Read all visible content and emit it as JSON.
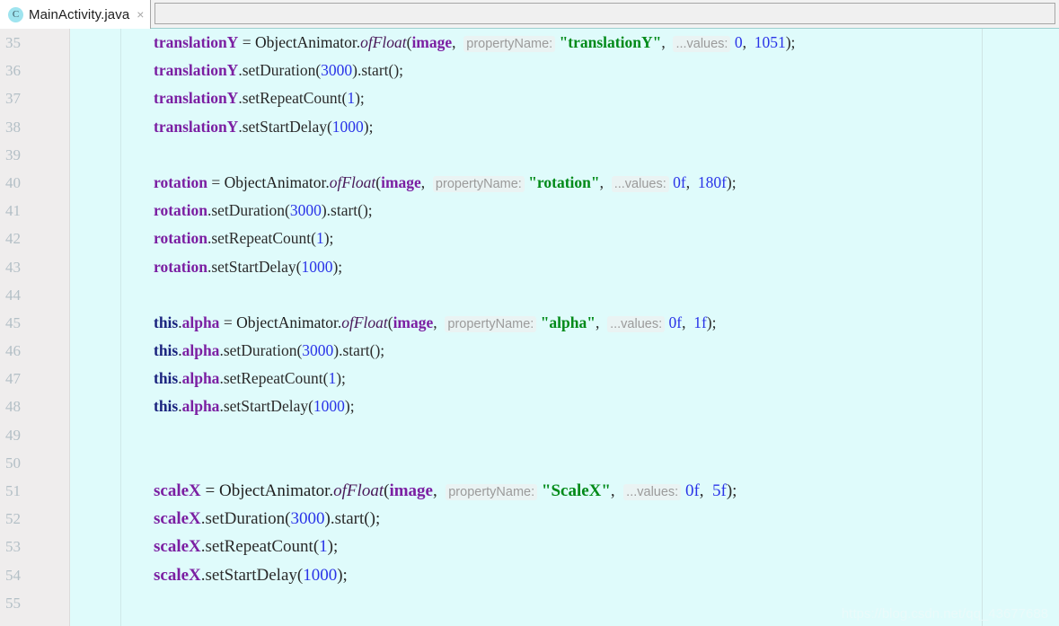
{
  "window": {
    "title": "MainActivity.java"
  },
  "tab": {
    "icon": "java-class-icon",
    "icon_letter": "C",
    "label": "MainActivity.java",
    "close_label": "×"
  },
  "editor": {
    "background": "#dffbfb",
    "gutter_background": "#efeded",
    "line_number_color": "#b3bfc6",
    "accent_string_color": "#018a18",
    "accent_field_color": "#7b1fa2",
    "accent_number_color": "#2a34e8",
    "first_line_number": 35,
    "last_line_number": 55,
    "line_numbers": [
      35,
      36,
      37,
      38,
      39,
      40,
      41,
      42,
      43,
      44,
      45,
      46,
      47,
      48,
      49,
      50,
      51,
      52,
      53,
      54,
      55
    ],
    "lines": [
      {
        "n": 35,
        "big": false,
        "tokens": [
          {
            "t": "field",
            "v": "translationY"
          },
          {
            "t": "punc",
            "v": " = "
          },
          {
            "t": "cls",
            "v": "ObjectAnimator"
          },
          {
            "t": "punc",
            "v": "."
          },
          {
            "t": "static",
            "v": "ofFloat"
          },
          {
            "t": "punc",
            "v": "("
          },
          {
            "t": "field",
            "v": "image"
          },
          {
            "t": "punc",
            "v": ",  "
          },
          {
            "t": "hint",
            "v": "propertyName:"
          },
          {
            "t": "punc",
            "v": " "
          },
          {
            "t": "str",
            "v": "\"translationY\""
          },
          {
            "t": "punc",
            "v": ",  "
          },
          {
            "t": "hint",
            "v": "...values:"
          },
          {
            "t": "punc",
            "v": " "
          },
          {
            "t": "num",
            "v": "0"
          },
          {
            "t": "punc",
            "v": ",  "
          },
          {
            "t": "num",
            "v": "1051"
          },
          {
            "t": "punc",
            "v": ");"
          }
        ]
      },
      {
        "n": 36,
        "big": false,
        "tokens": [
          {
            "t": "field",
            "v": "translationY"
          },
          {
            "t": "punc",
            "v": "."
          },
          {
            "t": "method",
            "v": "setDuration"
          },
          {
            "t": "punc",
            "v": "("
          },
          {
            "t": "num",
            "v": "3000"
          },
          {
            "t": "punc",
            "v": ")."
          },
          {
            "t": "method",
            "v": "start"
          },
          {
            "t": "punc",
            "v": "();"
          }
        ]
      },
      {
        "n": 37,
        "big": false,
        "tokens": [
          {
            "t": "field",
            "v": "translationY"
          },
          {
            "t": "punc",
            "v": "."
          },
          {
            "t": "method",
            "v": "setRepeatCount"
          },
          {
            "t": "punc",
            "v": "("
          },
          {
            "t": "num",
            "v": "1"
          },
          {
            "t": "punc",
            "v": ");"
          }
        ]
      },
      {
        "n": 38,
        "big": false,
        "tokens": [
          {
            "t": "field",
            "v": "translationY"
          },
          {
            "t": "punc",
            "v": "."
          },
          {
            "t": "method",
            "v": "setStartDelay"
          },
          {
            "t": "punc",
            "v": "("
          },
          {
            "t": "num",
            "v": "1000"
          },
          {
            "t": "punc",
            "v": ");"
          }
        ]
      },
      {
        "n": 39,
        "big": false,
        "tokens": []
      },
      {
        "n": 40,
        "big": false,
        "tokens": [
          {
            "t": "field",
            "v": "rotation"
          },
          {
            "t": "punc",
            "v": " = "
          },
          {
            "t": "cls",
            "v": "ObjectAnimator"
          },
          {
            "t": "punc",
            "v": "."
          },
          {
            "t": "static",
            "v": "ofFloat"
          },
          {
            "t": "punc",
            "v": "("
          },
          {
            "t": "field",
            "v": "image"
          },
          {
            "t": "punc",
            "v": ",  "
          },
          {
            "t": "hint",
            "v": "propertyName:"
          },
          {
            "t": "punc",
            "v": " "
          },
          {
            "t": "str",
            "v": "\"rotation\""
          },
          {
            "t": "punc",
            "v": ",  "
          },
          {
            "t": "hint",
            "v": "...values:"
          },
          {
            "t": "punc",
            "v": " "
          },
          {
            "t": "num",
            "v": "0f"
          },
          {
            "t": "punc",
            "v": ",  "
          },
          {
            "t": "num",
            "v": "180f"
          },
          {
            "t": "punc",
            "v": ");"
          }
        ]
      },
      {
        "n": 41,
        "big": false,
        "tokens": [
          {
            "t": "field",
            "v": "rotation"
          },
          {
            "t": "punc",
            "v": "."
          },
          {
            "t": "method",
            "v": "setDuration"
          },
          {
            "t": "punc",
            "v": "("
          },
          {
            "t": "num",
            "v": "3000"
          },
          {
            "t": "punc",
            "v": ")."
          },
          {
            "t": "method",
            "v": "start"
          },
          {
            "t": "punc",
            "v": "();"
          }
        ]
      },
      {
        "n": 42,
        "big": false,
        "tokens": [
          {
            "t": "field",
            "v": "rotation"
          },
          {
            "t": "punc",
            "v": "."
          },
          {
            "t": "method",
            "v": "setRepeatCount"
          },
          {
            "t": "punc",
            "v": "("
          },
          {
            "t": "num",
            "v": "1"
          },
          {
            "t": "punc",
            "v": ");"
          }
        ]
      },
      {
        "n": 43,
        "big": false,
        "tokens": [
          {
            "t": "field",
            "v": "rotation"
          },
          {
            "t": "punc",
            "v": "."
          },
          {
            "t": "method",
            "v": "setStartDelay"
          },
          {
            "t": "punc",
            "v": "("
          },
          {
            "t": "num",
            "v": "1000"
          },
          {
            "t": "punc",
            "v": ");"
          }
        ]
      },
      {
        "n": 44,
        "big": false,
        "tokens": []
      },
      {
        "n": 45,
        "big": false,
        "tokens": [
          {
            "t": "kw",
            "v": "this"
          },
          {
            "t": "punc",
            "v": "."
          },
          {
            "t": "field",
            "v": "alpha"
          },
          {
            "t": "punc",
            "v": " = "
          },
          {
            "t": "cls",
            "v": "ObjectAnimator"
          },
          {
            "t": "punc",
            "v": "."
          },
          {
            "t": "static",
            "v": "ofFloat"
          },
          {
            "t": "punc",
            "v": "("
          },
          {
            "t": "field",
            "v": "image"
          },
          {
            "t": "punc",
            "v": ",  "
          },
          {
            "t": "hint",
            "v": "propertyName:"
          },
          {
            "t": "punc",
            "v": " "
          },
          {
            "t": "str",
            "v": "\"alpha\""
          },
          {
            "t": "punc",
            "v": ",  "
          },
          {
            "t": "hint",
            "v": "...values:"
          },
          {
            "t": "punc",
            "v": " "
          },
          {
            "t": "num",
            "v": "0f"
          },
          {
            "t": "punc",
            "v": ",  "
          },
          {
            "t": "num",
            "v": "1f"
          },
          {
            "t": "punc",
            "v": ");"
          }
        ]
      },
      {
        "n": 46,
        "big": false,
        "tokens": [
          {
            "t": "kw",
            "v": "this"
          },
          {
            "t": "punc",
            "v": "."
          },
          {
            "t": "field",
            "v": "alpha"
          },
          {
            "t": "punc",
            "v": "."
          },
          {
            "t": "method",
            "v": "setDuration"
          },
          {
            "t": "punc",
            "v": "("
          },
          {
            "t": "num",
            "v": "3000"
          },
          {
            "t": "punc",
            "v": ")."
          },
          {
            "t": "method",
            "v": "start"
          },
          {
            "t": "punc",
            "v": "();"
          }
        ]
      },
      {
        "n": 47,
        "big": false,
        "tokens": [
          {
            "t": "kw",
            "v": "this"
          },
          {
            "t": "punc",
            "v": "."
          },
          {
            "t": "field",
            "v": "alpha"
          },
          {
            "t": "punc",
            "v": "."
          },
          {
            "t": "method",
            "v": "setRepeatCount"
          },
          {
            "t": "punc",
            "v": "("
          },
          {
            "t": "num",
            "v": "1"
          },
          {
            "t": "punc",
            "v": ");"
          }
        ]
      },
      {
        "n": 48,
        "big": false,
        "tokens": [
          {
            "t": "kw",
            "v": "this"
          },
          {
            "t": "punc",
            "v": "."
          },
          {
            "t": "field",
            "v": "alpha"
          },
          {
            "t": "punc",
            "v": "."
          },
          {
            "t": "method",
            "v": "setStartDelay"
          },
          {
            "t": "punc",
            "v": "("
          },
          {
            "t": "num",
            "v": "1000"
          },
          {
            "t": "punc",
            "v": ");"
          }
        ]
      },
      {
        "n": 49,
        "big": false,
        "tokens": []
      },
      {
        "n": 50,
        "big": false,
        "tokens": []
      },
      {
        "n": 51,
        "big": true,
        "tokens": [
          {
            "t": "field",
            "v": "scaleX"
          },
          {
            "t": "punc",
            "v": " = "
          },
          {
            "t": "cls",
            "v": "ObjectAnimator"
          },
          {
            "t": "punc",
            "v": "."
          },
          {
            "t": "static",
            "v": "ofFloat"
          },
          {
            "t": "punc",
            "v": "("
          },
          {
            "t": "field",
            "v": "image"
          },
          {
            "t": "punc",
            "v": ",  "
          },
          {
            "t": "hint",
            "v": "propertyName:"
          },
          {
            "t": "punc",
            "v": " "
          },
          {
            "t": "str",
            "v": "\"ScaleX\""
          },
          {
            "t": "punc",
            "v": ",  "
          },
          {
            "t": "hint",
            "v": "...values:"
          },
          {
            "t": "punc",
            "v": " "
          },
          {
            "t": "num",
            "v": "0f"
          },
          {
            "t": "punc",
            "v": ",  "
          },
          {
            "t": "num",
            "v": "5f"
          },
          {
            "t": "punc",
            "v": ");"
          }
        ]
      },
      {
        "n": 52,
        "big": true,
        "tokens": [
          {
            "t": "field",
            "v": "scaleX"
          },
          {
            "t": "punc",
            "v": "."
          },
          {
            "t": "method",
            "v": "setDuration"
          },
          {
            "t": "punc",
            "v": "("
          },
          {
            "t": "num",
            "v": "3000"
          },
          {
            "t": "punc",
            "v": ")."
          },
          {
            "t": "method",
            "v": "start"
          },
          {
            "t": "punc",
            "v": "();"
          }
        ]
      },
      {
        "n": 53,
        "big": true,
        "tokens": [
          {
            "t": "field",
            "v": "scaleX"
          },
          {
            "t": "punc",
            "v": "."
          },
          {
            "t": "method",
            "v": "setRepeatCount"
          },
          {
            "t": "punc",
            "v": "("
          },
          {
            "t": "num",
            "v": "1"
          },
          {
            "t": "punc",
            "v": ");"
          }
        ]
      },
      {
        "n": 54,
        "big": true,
        "tokens": [
          {
            "t": "field",
            "v": "scaleX"
          },
          {
            "t": "punc",
            "v": "."
          },
          {
            "t": "method",
            "v": "setStartDelay"
          },
          {
            "t": "punc",
            "v": "("
          },
          {
            "t": "num",
            "v": "1000"
          },
          {
            "t": "punc",
            "v": ");"
          }
        ]
      },
      {
        "n": 55,
        "big": false,
        "tokens": []
      }
    ]
  },
  "watermark": {
    "text": "https://blog.csdn.net/qq_43677688"
  }
}
